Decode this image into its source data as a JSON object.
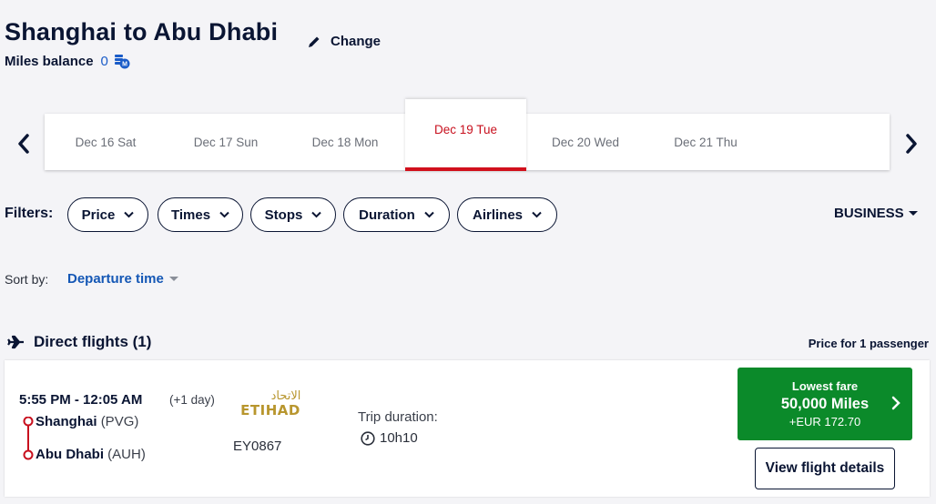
{
  "header": {
    "title": "Shanghai to Abu Dhabi",
    "change_label": "Change",
    "miles_label": "Miles balance",
    "miles_value": "0"
  },
  "dates": [
    {
      "label": "Dec 16 Sat",
      "active": false
    },
    {
      "label": "Dec 17 Sun",
      "active": false
    },
    {
      "label": "Dec 18 Mon",
      "active": false
    },
    {
      "label": "Dec 19 Tue",
      "active": true
    },
    {
      "label": "Dec 20 Wed",
      "active": false
    },
    {
      "label": "Dec 21 Thu",
      "active": false
    }
  ],
  "filters": {
    "label": "Filters:",
    "items": [
      "Price",
      "Times",
      "Stops",
      "Duration",
      "Airlines"
    ],
    "cabin": "BUSINESS"
  },
  "sort": {
    "label": "Sort by:",
    "value": "Departure time"
  },
  "section": {
    "title": "Direct flights (1)",
    "price_for": "Price for 1 passenger"
  },
  "flight": {
    "times": "5:55 PM - 12:05 AM",
    "plus_day": "(+1 day)",
    "origin_city": "Shanghai",
    "origin_code": "(PVG)",
    "dest_city": "Abu Dhabi",
    "dest_code": "(AUH)",
    "airline": "ETIHAD",
    "airline_arabic": "الاتحاد",
    "flight_number": "EY0867",
    "trip_label": "Trip duration:",
    "duration": "10h10",
    "fare_label": "Lowest fare",
    "fare_miles": "50,000 Miles",
    "fare_cash": "+EUR 172.70",
    "details_label": "View flight details"
  },
  "colors": {
    "accent_red": "#d1101c",
    "fare_green": "#0b8a2a",
    "link_blue": "#1457b5",
    "navy": "#0a1533",
    "etihad_gold": "#b8962e"
  }
}
